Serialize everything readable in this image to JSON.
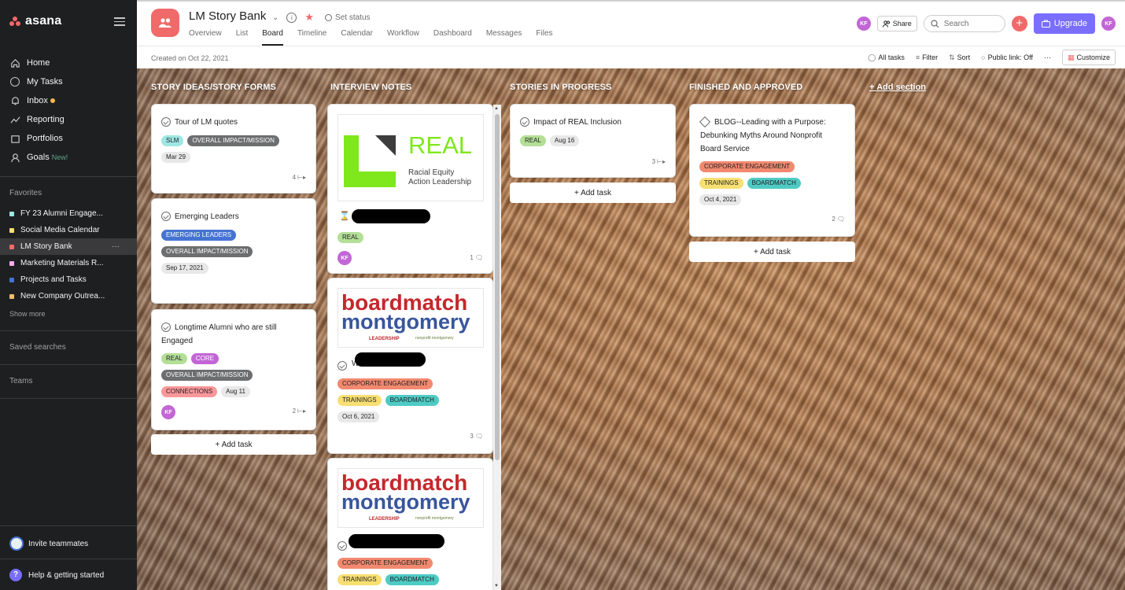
{
  "sidebar": {
    "logo": "asana",
    "nav": [
      {
        "label": "Home",
        "icon": "home-icon"
      },
      {
        "label": "My Tasks",
        "icon": "check-circle-icon"
      },
      {
        "label": "Inbox",
        "icon": "bell-icon"
      },
      {
        "label": "Reporting",
        "icon": "trend-icon"
      },
      {
        "label": "Portfolios",
        "icon": "folder-icon"
      },
      {
        "label": "Goals",
        "icon": "person-icon",
        "badge": "New!"
      }
    ],
    "favorites_label": "Favorites",
    "favorites": [
      {
        "label": "FY 23 Alumni Engage...",
        "color": "#9ee7e3"
      },
      {
        "label": "Social Media Calendar",
        "color": "#f8df72"
      },
      {
        "label": "LM Story Bank",
        "color": "#f06a6a",
        "more": "···"
      },
      {
        "label": "Marketing Materials R...",
        "color": "#f9aaef"
      },
      {
        "label": "Projects and Tasks",
        "color": "#4573d2"
      },
      {
        "label": "New Company Outrea...",
        "color": "#f1bd6c"
      }
    ],
    "show_more": "Show more",
    "saved_searches": "Saved searches",
    "teams": "Teams",
    "invite": "Invite teammates",
    "help": "Help & getting started"
  },
  "header": {
    "title": "LM Story Bank",
    "set_status": "Set status",
    "tabs": [
      "Overview",
      "List",
      "Board",
      "Timeline",
      "Calendar",
      "Workflow",
      "Dashboard",
      "Messages",
      "Files"
    ],
    "active_tab": "Board",
    "avatar": "KF",
    "share": "Share",
    "search_placeholder": "Search",
    "upgrade": "Upgrade",
    "created": "Created on Oct 22, 2021",
    "toolbar": {
      "all_tasks": "All tasks",
      "filter": "Filter",
      "sort": "Sort",
      "public_link": "Public link: Off",
      "more": "···",
      "customize": "Customize"
    }
  },
  "board": {
    "columns": [
      {
        "title": "STORY IDEAS/STORY FORMS"
      },
      {
        "title": "INTERVIEW NOTES"
      },
      {
        "title": "STORIES IN PROGRESS"
      },
      {
        "title": "FINISHED AND APPROVED"
      }
    ],
    "add_section": "+ Add section",
    "add_task": "+ Add task",
    "cards": {
      "c1": {
        "title": "Tour of LM quotes",
        "tags": [
          "SLM",
          "OVERALL IMPACT/MISSION"
        ],
        "date": "Mar 29",
        "subtasks": "4"
      },
      "c2": {
        "title": "Emerging Leaders",
        "tags": [
          "EMERGING LEADERS",
          "OVERALL IMPACT/MISSION"
        ],
        "date": "Sep 17, 2021"
      },
      "c3": {
        "title_line1": "Longtime Alumni who are still",
        "title_line2": "Engaged",
        "tags": [
          "REAL",
          "CORE",
          "OVERALL IMPACT/MISSION",
          "CONNECTIONS"
        ],
        "date": "Aug 11",
        "avatar": "KF",
        "subtasks": "2"
      },
      "c4": {
        "logo_big": "REAL",
        "logo_sub1": "Racial Equity",
        "logo_sub2": "Action Leadership",
        "tags": [
          "REAL"
        ],
        "avatar": "KF",
        "comments": "1"
      },
      "c5": {
        "logo_line1": "boardmatch",
        "logo_line2": "montgomery",
        "logo_small1": "LEADERSHIP",
        "logo_small2": "nonprofit montgomery",
        "title_prefix": "W",
        "tags": [
          "CORPORATE ENGAGEMENT",
          "TRAININGS",
          "BOARDMATCH"
        ],
        "date": "Oct 6, 2021",
        "comments": "3"
      },
      "c6": {
        "logo_line1": "boardmatch",
        "logo_line2": "montgomery",
        "logo_small1": "LEADERSHIP",
        "logo_small2": "nonprofit montgomery",
        "tags": [
          "CORPORATE ENGAGEMENT",
          "TRAININGS",
          "BOARDMATCH"
        ]
      },
      "c7": {
        "title": "Impact of REAL Inclusion",
        "tags": [
          "REAL"
        ],
        "date": "Aug 16",
        "subtasks": "3"
      },
      "c8": {
        "title_line1": "BLOG--Leading with a Purpose:",
        "title_line2": "Debunking Myths Around Nonprofit",
        "title_line3": "Board Service",
        "tags": [
          "CORPORATE ENGAGEMENT",
          "TRAININGS",
          "BOARDMATCH"
        ],
        "date": "Oct 4, 2021",
        "comments": "2"
      }
    }
  }
}
